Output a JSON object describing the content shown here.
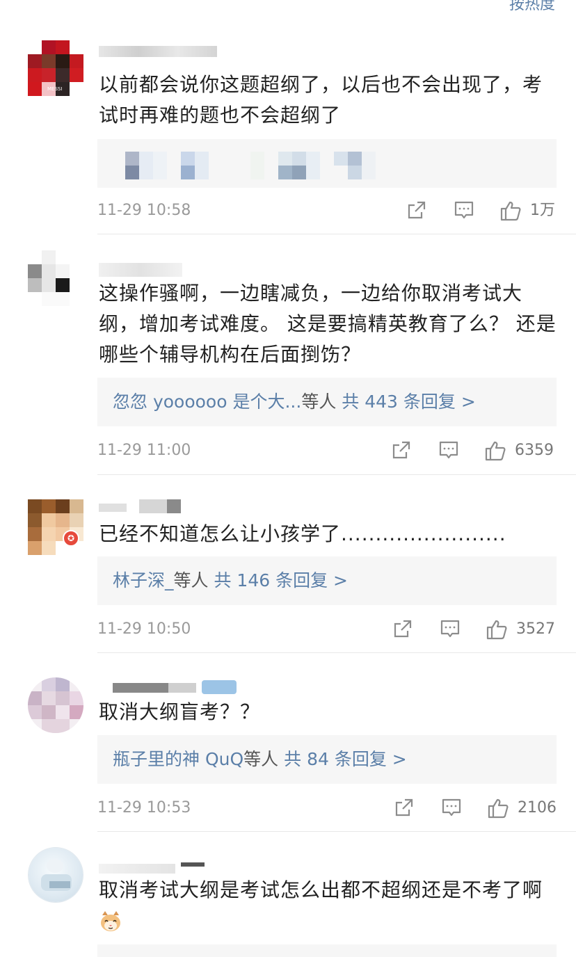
{
  "header": {
    "sort_label": "按热度"
  },
  "comments": [
    {
      "text": "以前都会说你这题超纲了，以后也不会出现了，考试时再难的题也不会超纲了",
      "time": "11-29 10:58",
      "likes": "1万",
      "avatar_badge": "MESSI"
    },
    {
      "text": "这操作骚啊，一边瞎减负，一边给你取消考试大纲，增加考试难度。 这是要搞精英教育了么？ 还是哪些个辅导机构在后面捯饬？",
      "reply_who": "忽忽 yoooooo 是个大...",
      "reply_etc": "等人",
      "reply_count": "共 443 条回复 >",
      "time": "11-29 11:00",
      "likes": "6359"
    },
    {
      "text": "已经不知道怎么让小孩学了........................",
      "reply_who": "林子深_",
      "reply_etc": "等人",
      "reply_count": "共 146 条回复 >",
      "time": "11-29 10:50",
      "likes": "3527"
    },
    {
      "text": "取消大纲盲考？？",
      "reply_who": "瓶子里的神 QuQ",
      "reply_etc": "等人",
      "reply_count": "共 84 条回复 >",
      "time": "11-29 10:53",
      "likes": "2106"
    },
    {
      "text": "取消考试大纲是考试怎么出都不超纲还是不考了啊"
    }
  ],
  "colors": {
    "link": "#5b7fa8",
    "meta": "#9a9a9a",
    "reply_bg": "#f6f6f6"
  },
  "icons": [
    "share-icon",
    "comment-icon",
    "thumbs-up-icon",
    "cat-emoji-icon"
  ]
}
